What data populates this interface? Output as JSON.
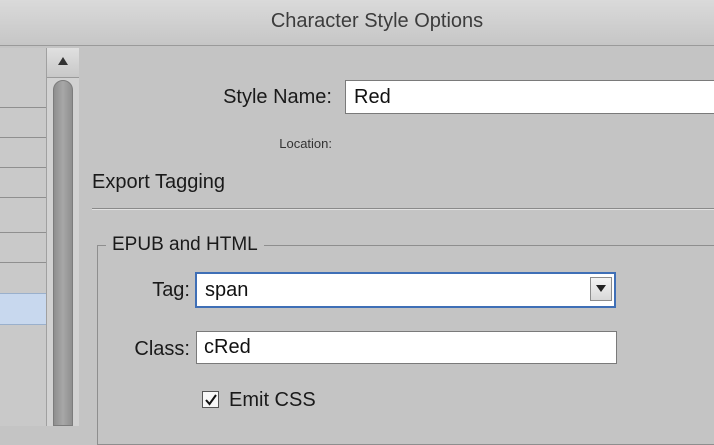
{
  "window": {
    "title": "Character Style Options"
  },
  "general": {
    "style_name_label": "Style Name:",
    "style_name_value": "Red",
    "location_label": "Location:"
  },
  "section": {
    "heading": "Export Tagging"
  },
  "epub_html": {
    "group_title": "EPUB and HTML",
    "tag_label": "Tag:",
    "tag_value": "span",
    "class_label": "Class:",
    "class_value": "cRed",
    "emit_css_label": "Emit CSS",
    "emit_css_checked": true
  },
  "colors": {
    "dialog_bg": "#c4c4c4",
    "focus_ring": "#3f6fb6",
    "selected_row": "#c8d8ee"
  },
  "icons": {
    "scroll_up": "triangle-up-icon",
    "dropdown": "triangle-down-icon",
    "checkmark": "checkmark-icon"
  }
}
